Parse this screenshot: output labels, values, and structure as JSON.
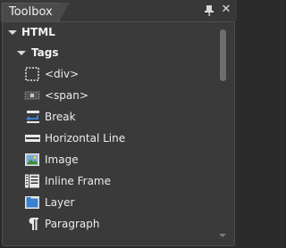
{
  "panel": {
    "title": "Toolbox"
  },
  "groups": [
    {
      "label": "HTML"
    },
    {
      "label": "Tags"
    }
  ],
  "items": [
    {
      "label": "<div>",
      "icon": "div-icon"
    },
    {
      "label": "<span>",
      "icon": "span-icon"
    },
    {
      "label": "Break",
      "icon": "break-icon"
    },
    {
      "label": "Horizontal Line",
      "icon": "horizontal-line-icon"
    },
    {
      "label": "Image",
      "icon": "image-icon"
    },
    {
      "label": "Inline Frame",
      "icon": "inline-frame-icon"
    },
    {
      "label": "Layer",
      "icon": "layer-icon"
    },
    {
      "label": "Paragraph",
      "icon": "paragraph-icon"
    }
  ],
  "colors": {
    "background": "#2b2b2b",
    "panel": "#3a3a3a",
    "text": "#ececec",
    "icon_blue": "#3a7fd0"
  }
}
